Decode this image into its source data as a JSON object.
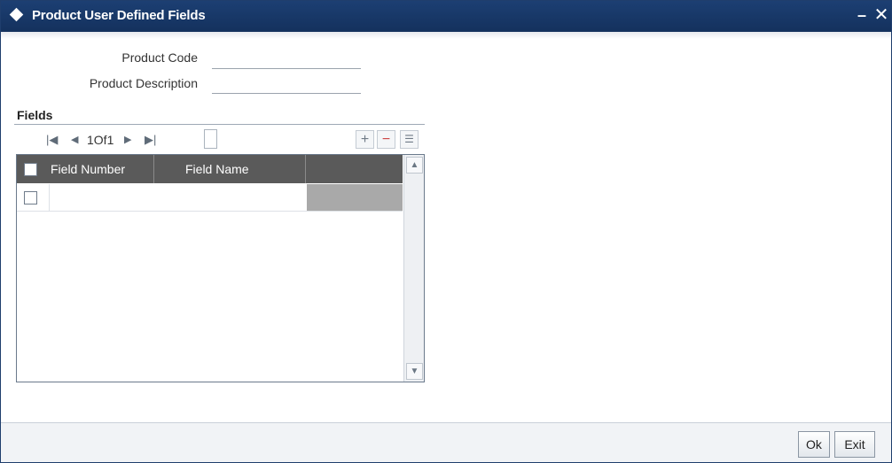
{
  "window": {
    "title": "Product User Defined Fields",
    "minimize_icon": "minimize-icon",
    "close_icon": "close-icon"
  },
  "form": {
    "product_code_label": "Product Code",
    "product_code_value": "",
    "product_description_label": "Product Description",
    "product_description_value": ""
  },
  "fields_section": {
    "title": "Fields",
    "pagination": {
      "current": "1",
      "of_label": "Of",
      "total": "1"
    },
    "toolbar": {
      "add_icon": "plus-icon",
      "delete_icon": "minus-icon",
      "view_icon": "list-view-icon"
    },
    "grid": {
      "columns": [
        "Field Number",
        "Field Name",
        ""
      ],
      "rows": [
        {
          "field_number": "",
          "field_name": ""
        }
      ]
    }
  },
  "footer": {
    "ok_label": "Ok",
    "exit_label": "Exit"
  }
}
